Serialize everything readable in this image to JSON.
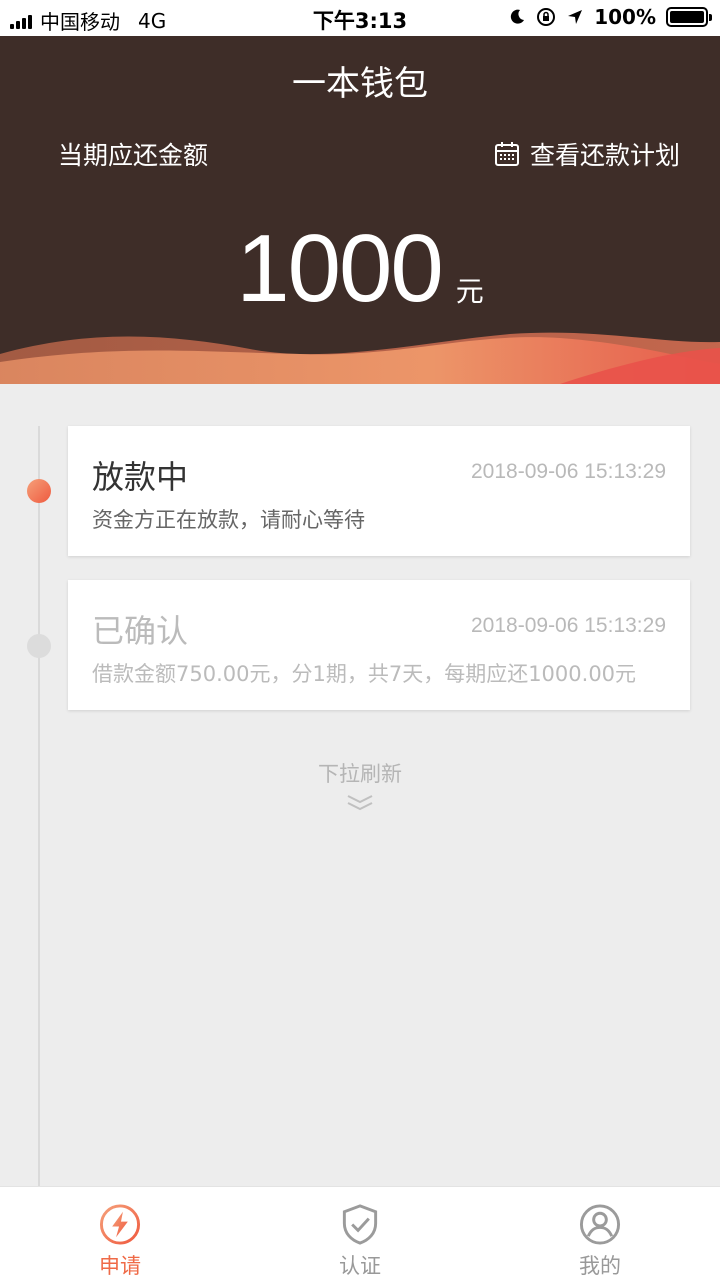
{
  "status_bar": {
    "carrier": "中国移动",
    "network": "4G",
    "time": "下午3:13",
    "battery": "100%"
  },
  "header": {
    "title": "一本钱包",
    "due_label": "当期应还金额",
    "plan_link": "查看还款计划",
    "amount": "1000",
    "unit": "元"
  },
  "timeline": [
    {
      "title": "放款中",
      "time": "2018-09-06 15:13:29",
      "desc": "资金方正在放款，请耐心等待",
      "active": true
    },
    {
      "title": "已确认",
      "time": "2018-09-06 15:13:29",
      "desc": "借款金额750.00元，分1期，共7天，每期应还1000.00元",
      "active": false
    }
  ],
  "pull_refresh": "下拉刷新",
  "tabs": [
    {
      "label": "申请",
      "icon": "lightning-icon"
    },
    {
      "label": "认证",
      "icon": "shield-check-icon"
    },
    {
      "label": "我的",
      "icon": "user-icon"
    }
  ],
  "colors": {
    "header_bg": "#3e2d28",
    "accent": "#ef6a47",
    "background": "#ededed"
  }
}
